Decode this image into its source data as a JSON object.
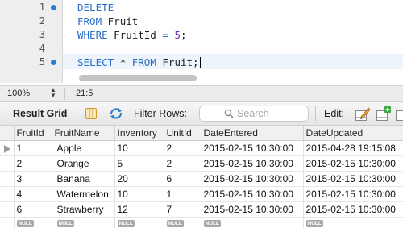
{
  "editor": {
    "line_numbers": [
      "1",
      "2",
      "3",
      "4",
      "5"
    ],
    "lines": [
      [
        {
          "t": "DELETE",
          "k": "kw"
        }
      ],
      [
        {
          "t": "FROM ",
          "k": "kw"
        },
        {
          "t": "Fruit",
          "k": "id"
        }
      ],
      [
        {
          "t": "WHERE ",
          "k": "kw"
        },
        {
          "t": "FruitId ",
          "k": "id"
        },
        {
          "t": "= ",
          "k": "kw"
        },
        {
          "t": "5",
          "k": "num"
        },
        {
          "t": ";",
          "k": "id"
        }
      ],
      [],
      [
        {
          "t": "SELECT ",
          "k": "kw"
        },
        {
          "t": "* ",
          "k": "id"
        },
        {
          "t": "FROM ",
          "k": "kw"
        },
        {
          "t": "Fruit;",
          "k": "id"
        }
      ]
    ],
    "breakpoint_color": "#2a7fd4"
  },
  "status": {
    "zoom": "100%",
    "cursor_position": "21:5"
  },
  "toolbar": {
    "result_grid_label": "Result Grid",
    "filter_label": "Filter Rows:",
    "search_placeholder": "Search",
    "edit_label": "Edit:"
  },
  "grid": {
    "columns": [
      "FruitId",
      "FruitName",
      "Inventory",
      "UnitId",
      "DateEntered",
      "DateUpdated"
    ],
    "rows": [
      [
        "1",
        "Apple",
        "10",
        "2",
        "2015-02-15 10:30:00",
        "2015-04-28 19:15:08"
      ],
      [
        "2",
        "Orange",
        "5",
        "2",
        "2015-02-15 10:30:00",
        "2015-02-15 10:30:00"
      ],
      [
        "3",
        "Banana",
        "20",
        "6",
        "2015-02-15 10:30:00",
        "2015-02-15 10:30:00"
      ],
      [
        "4",
        "Watermelon",
        "10",
        "1",
        "2015-02-15 10:30:00",
        "2015-02-15 10:30:00"
      ],
      [
        "6",
        "Strawberry",
        "12",
        "7",
        "2015-02-15 10:30:00",
        "2015-02-15 10:30:00"
      ]
    ],
    "selected_row": 0,
    "null_label": "NULL"
  }
}
